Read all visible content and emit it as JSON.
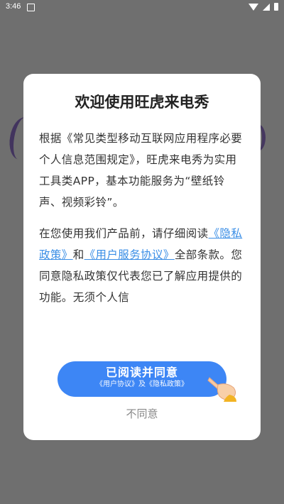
{
  "status_bar": {
    "time": "3:46"
  },
  "dialog": {
    "title": "欢迎使用旺虎来电秀",
    "paragraph1": "根据《常见类型移动互联网应用程序必要个人信息范围规定》，旺虎来电秀为实用工具类APP，基本功能服务为“壁纸铃声、视频彩铃”。",
    "paragraph2_prefix": "在您使用我们产品前，请仔细阅读",
    "privacy_link": "《隐私政策》",
    "connector": "和",
    "service_link": "《用户服务协议》",
    "paragraph2_suffix": "全部条款。您同意隐私政策仅代表您已了解应用提供的功能。无须个人信",
    "agree_label": "已阅读并同意",
    "agree_sublabel": "《用户协议》及《隐私政策》",
    "disagree_label": "不同意"
  },
  "colors": {
    "accent": "#3d86f5",
    "link": "#3a8ee6",
    "overlay": "#6f6f6f"
  }
}
